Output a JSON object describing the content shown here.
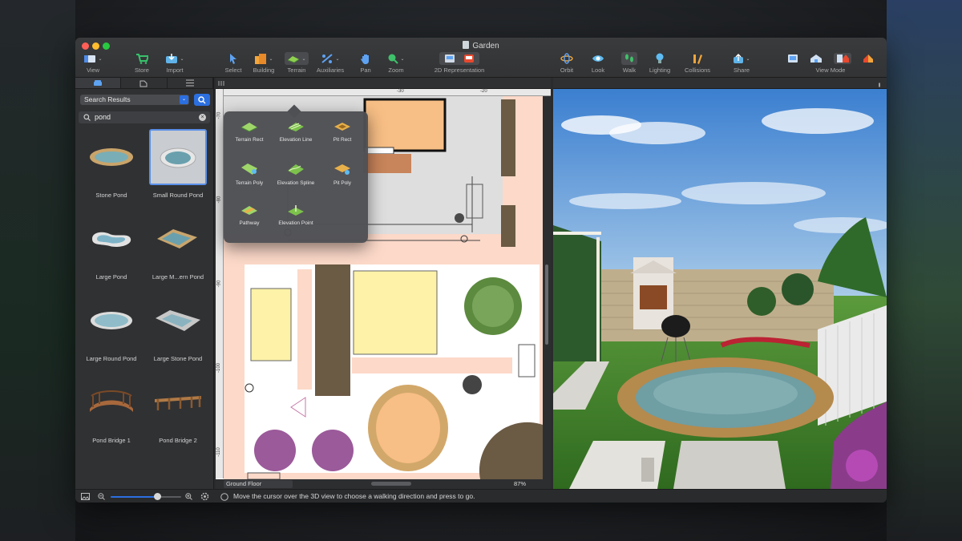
{
  "window": {
    "title": "Garden"
  },
  "toolbar": {
    "view": "View",
    "store": "Store",
    "import": "Import",
    "select": "Select",
    "building": "Building",
    "terrain": "Terrain",
    "auxiliaries": "Auxiliaries",
    "pan": "Pan",
    "zoom": "Zoom",
    "representation_2d": "2D Representation",
    "orbit": "Orbit",
    "look": "Look",
    "walk": "Walk",
    "lighting": "Lighting",
    "collisions": "Collisions",
    "share": "Share",
    "view_mode": "View Mode"
  },
  "sidebar": {
    "filter": "Search Results",
    "search_value": "pond",
    "items": [
      {
        "label": "Stone Pond"
      },
      {
        "label": "Small Round Pond",
        "selected": true
      },
      {
        "label": "Large Pond"
      },
      {
        "label": "Large M...ern Pond"
      },
      {
        "label": "Large Round Pond"
      },
      {
        "label": "Large Stone Pond"
      },
      {
        "label": "Pond Bridge 1"
      },
      {
        "label": "Pond Bridge 2"
      }
    ],
    "zoom_slider_fraction": 0.66
  },
  "terrain_menu": {
    "items": [
      {
        "label": "Terrain Rect"
      },
      {
        "label": "Elevation Line"
      },
      {
        "label": "Pit Rect"
      },
      {
        "label": "Terrain Poly"
      },
      {
        "label": "Elevation Spline"
      },
      {
        "label": "Pit Poly"
      },
      {
        "label": "Pathway"
      },
      {
        "label": "Elevation Point"
      }
    ]
  },
  "plan": {
    "ruler_top": [
      "-30",
      "-20"
    ],
    "ruler_left": [
      "-70",
      "-80",
      "-90",
      "-100",
      "-110"
    ],
    "floor": "Ground Floor",
    "zoom": "87%",
    "unit": "ft"
  },
  "status": {
    "message": "Move the cursor over the 3D view to choose a walking direction and press to go."
  },
  "colors": {
    "accent": "#2b6fe0",
    "path_pink": "#fcd9c9",
    "sand": "#f7be85",
    "lawn_yellow": "#fdf2a8",
    "grass": "#4a8a34",
    "water": "#6f9ea3"
  }
}
